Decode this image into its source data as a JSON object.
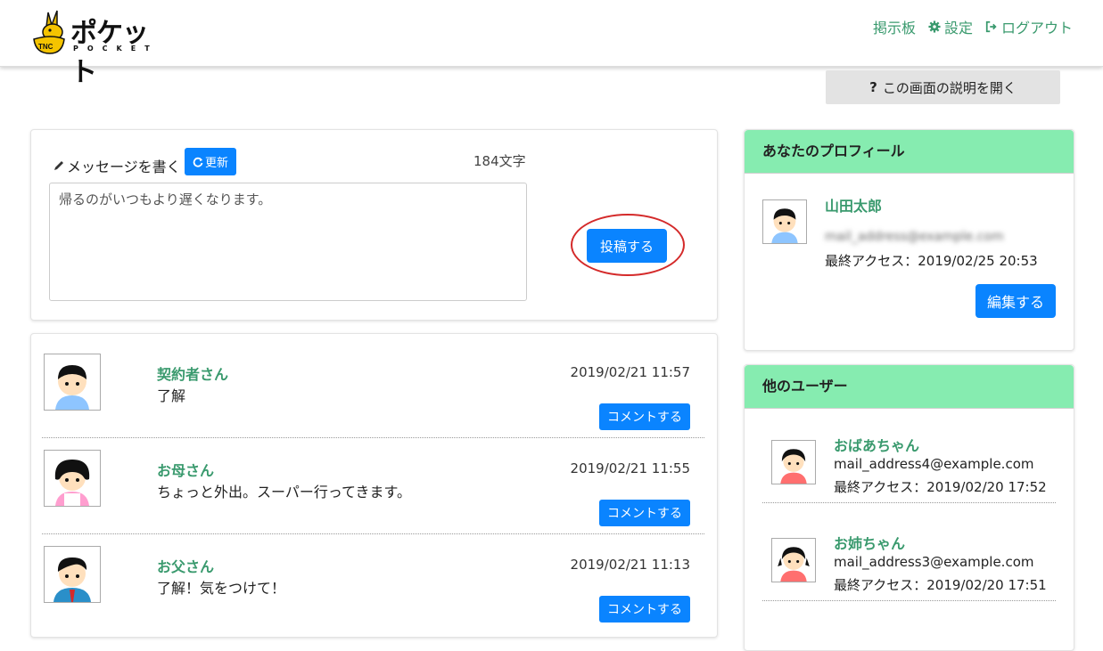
{
  "header": {
    "logo_text": "ポケット",
    "logo_sub": "POCKET",
    "logo_badge": "TNC",
    "nav": [
      {
        "label": "掲示板",
        "icon": ""
      },
      {
        "label": "設定",
        "icon": "gear-icon"
      },
      {
        "label": "ログアウト",
        "icon": "logout-icon"
      }
    ]
  },
  "help": {
    "icon": "?",
    "label": "この画面の説明を開く"
  },
  "compose": {
    "label": "メッセージを書く",
    "update_label": "更新",
    "char_count": "184文字",
    "message_value": "帰るのがいつもより遅くなります。",
    "post_label": "投稿する"
  },
  "posts": [
    {
      "author": "契約者さん",
      "text": "了解",
      "time": "2019/02/21 11:57",
      "comment_label": "コメントする",
      "avatar": "boy-avatar"
    },
    {
      "author": "お母さん",
      "text": "ちょっと外出。スーパー行ってきます。",
      "time": "2019/02/21 11:55",
      "comment_label": "コメントする",
      "avatar": "mother-avatar"
    },
    {
      "author": "お父さん",
      "text": "了解！気をつけて！",
      "time": "2019/02/21 11:13",
      "comment_label": "コメントする",
      "avatar": "father-avatar"
    }
  ],
  "profile": {
    "title": "あなたのプロフィール",
    "name": "山田太郎",
    "email": "mail_address@example.com",
    "last_access": "最終アクセス：2019/02/25 20:53",
    "edit_label": "編集する"
  },
  "others": {
    "title": "他のユーザー",
    "users": [
      {
        "name": "おばあちゃん",
        "email": "mail_address4@example.com",
        "last_access": "最終アクセス：2019/02/20 17:52"
      },
      {
        "name": "お姉ちゃん",
        "email": "mail_address3@example.com",
        "last_access": "最終アクセス：2019/02/20 17:51"
      }
    ]
  },
  "colors": {
    "accent": "#0a84ff",
    "green": "#3a9a6e",
    "header_bg": "#86ecb0",
    "highlight": "#d42a2a"
  }
}
